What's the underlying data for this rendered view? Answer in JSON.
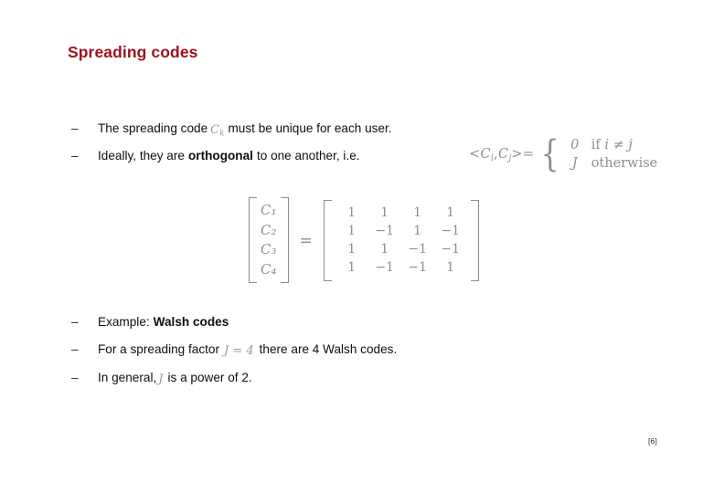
{
  "slide": {
    "title": "Spreading codes",
    "footer_reference": "[6]",
    "title_color": "#9e121b",
    "math_color": "#8e8e8e",
    "body_color": "#0f0f0f",
    "background_color": "#ffffff"
  },
  "bullets": [
    {
      "marker": "–",
      "text_before": "The spreading code",
      "math": {
        "base": "C",
        "sub": "k"
      },
      "text_after": "must be unique for each user."
    },
    {
      "marker": "–",
      "text_before": "Ideally, they are",
      "bold": "orthogonal",
      "text_after": "to one another, i.e."
    },
    {
      "marker": "–",
      "text_before": "Example:",
      "bold": "Walsh codes",
      "text_after": ""
    },
    {
      "marker": "–",
      "text_before": "For a spreading factor",
      "math": "J = 4",
      "text_after": "there are 4 Walsh codes."
    },
    {
      "marker": "–",
      "text_before": "In general,",
      "math": "J",
      "text_after": "is a power of 2."
    }
  ],
  "orthogonality_equation": {
    "lhs_open": "<",
    "lhs_c1": "C",
    "lhs_c1_sub": "i",
    "lhs_comma": ",",
    "lhs_c2": "C",
    "lhs_c2_sub": "j",
    "lhs_close": ">",
    "relation": "=",
    "cases": [
      {
        "value": "0",
        "condition_prefix": "if",
        "condition_math": "i ≠ j"
      },
      {
        "value": "J",
        "condition_prefix": "otherwise",
        "condition_math": ""
      }
    ]
  },
  "matrix_equation": {
    "vector_label": "C",
    "vector_entries": [
      "C₁",
      "C₂",
      "C₃",
      "C₄"
    ],
    "equals": "=",
    "walsh_matrix": [
      [
        "1",
        "1",
        "1",
        "1"
      ],
      [
        "1",
        "−1",
        "1",
        "−1"
      ],
      [
        "1",
        "1",
        "−1",
        "−1"
      ],
      [
        "1",
        "−1",
        "−1",
        "1"
      ]
    ]
  }
}
